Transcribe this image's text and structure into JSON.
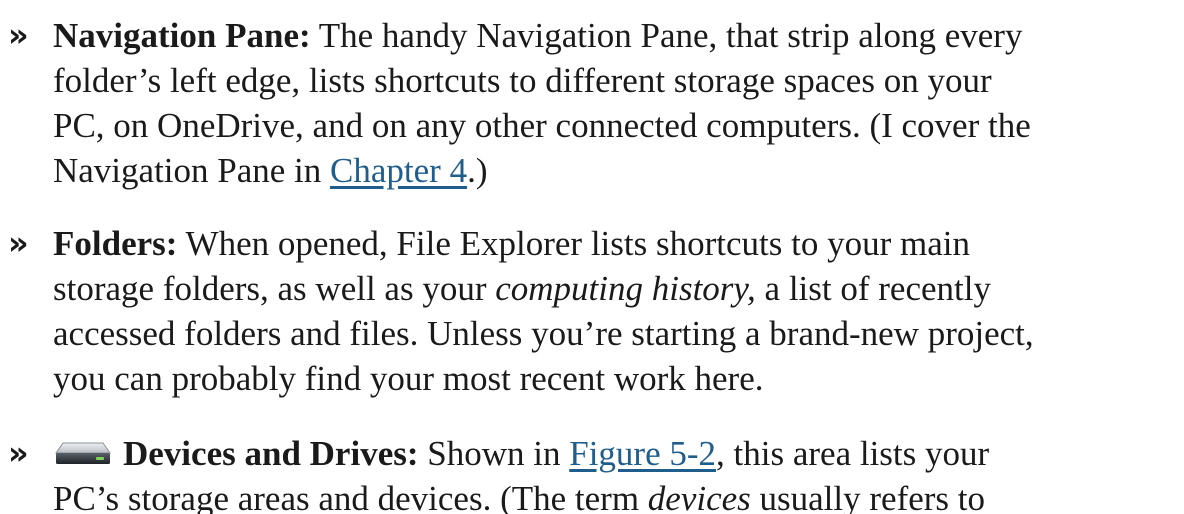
{
  "bullet_glyph": "»",
  "link_color": "#1f5e8c",
  "items": [
    {
      "term": "Navigation Pane:",
      "line1_rest": " The handy Navigation Pane, that strip along every",
      "line2": "folder’s left edge, lists shortcuts to different storage spaces on your",
      "line3": "PC, on OneDrive, and on any other connected computers. (I cover the",
      "line4_before": "Navigation Pane in ",
      "line4_link": "Chapter 4",
      "line4_after": ".)"
    },
    {
      "term": "Folders:",
      "line1_rest": " When opened, File Explorer lists shortcuts to your main",
      "line2_before": "storage folders, as well as your ",
      "line2_italic": "computing history,",
      "line2_after": " a list of recently",
      "line3": "accessed folders and files. Unless you’re starting a brand-new project,",
      "line4": "you can probably find your most recent work here."
    },
    {
      "icon": "drive-icon",
      "term": "Devices and Drives:",
      "line1_before": " Shown in ",
      "line1_link": "Figure 5-2",
      "line1_after": ", this area lists your",
      "line2_before": "PC’s storage areas and devices. (The term ",
      "line2_italic": "devices",
      "line2_after": " usually refers to"
    }
  ]
}
